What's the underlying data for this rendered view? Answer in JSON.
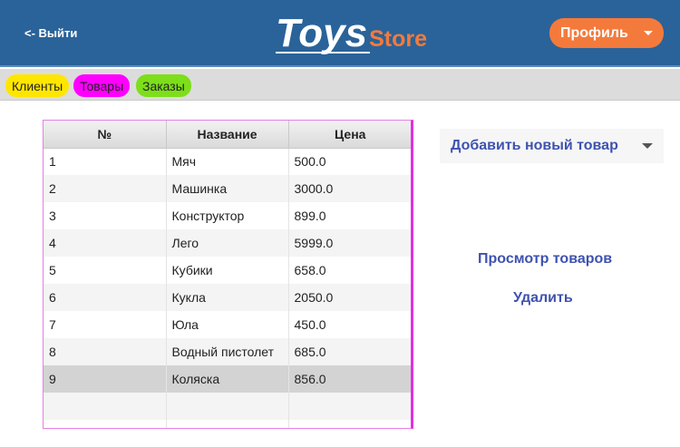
{
  "header": {
    "logout_label": "<- Выйти",
    "logo_main": "Toys",
    "logo_sub": "Store",
    "profile_label": "Профиль"
  },
  "tabs": [
    {
      "label": "Клиенты",
      "color": "#ffe600"
    },
    {
      "label": "Товары",
      "color": "#ff00ff"
    },
    {
      "label": "Заказы",
      "color": "#7dde1a"
    }
  ],
  "table": {
    "columns": [
      "№",
      "Название",
      "Цена"
    ],
    "rows": [
      [
        "1",
        "Мяч",
        "500.0"
      ],
      [
        "2",
        "Машинка",
        "3000.0"
      ],
      [
        "3",
        "Конструктор",
        "899.0"
      ],
      [
        "4",
        "Лего",
        "5999.0"
      ],
      [
        "5",
        "Кубики",
        "658.0"
      ],
      [
        "6",
        "Кукла",
        "2050.0"
      ],
      [
        "7",
        "Юла",
        "450.0"
      ],
      [
        "8",
        "Водный пистолет",
        "685.0"
      ],
      [
        "9",
        "Коляска",
        "856.0"
      ]
    ],
    "selected_row": 9
  },
  "actions": {
    "add_label": "Добавить новый товар",
    "view_label": "Просмотр товаров",
    "delete_label": "Удалить"
  },
  "colors": {
    "header_bg": "#2a6399",
    "accent": "#f47a3c",
    "link": "#3e52b0"
  }
}
